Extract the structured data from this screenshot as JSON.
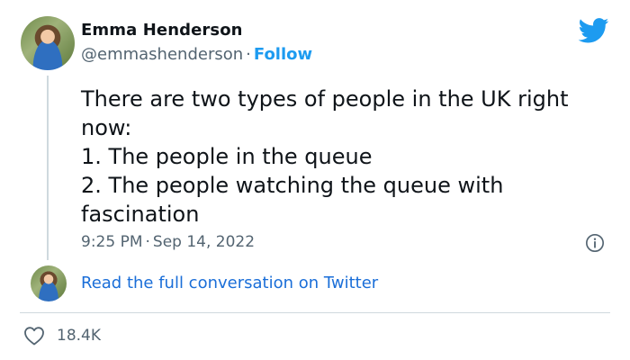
{
  "tweet": {
    "author_name": "Emma Henderson",
    "handle": "@emmashenderson",
    "separator": "·",
    "follow_label": "Follow",
    "text_lines": [
      "There are two types of people in the UK right",
      "now:",
      "1. The people in the queue",
      "2. The people watching the queue with",
      "fascination"
    ],
    "time": "9:25 PM",
    "date": "Sep 14, 2022",
    "read_link": "Read the full conversation on Twitter",
    "likes": "18.4K"
  },
  "icons": {
    "brand": "twitter-bird-icon",
    "info": "info-icon",
    "like": "heart-icon"
  },
  "colors": {
    "accent": "#1d9bf0",
    "link": "#1a6ed8",
    "secondary_text": "#536471",
    "divider": "#cfd9de"
  }
}
